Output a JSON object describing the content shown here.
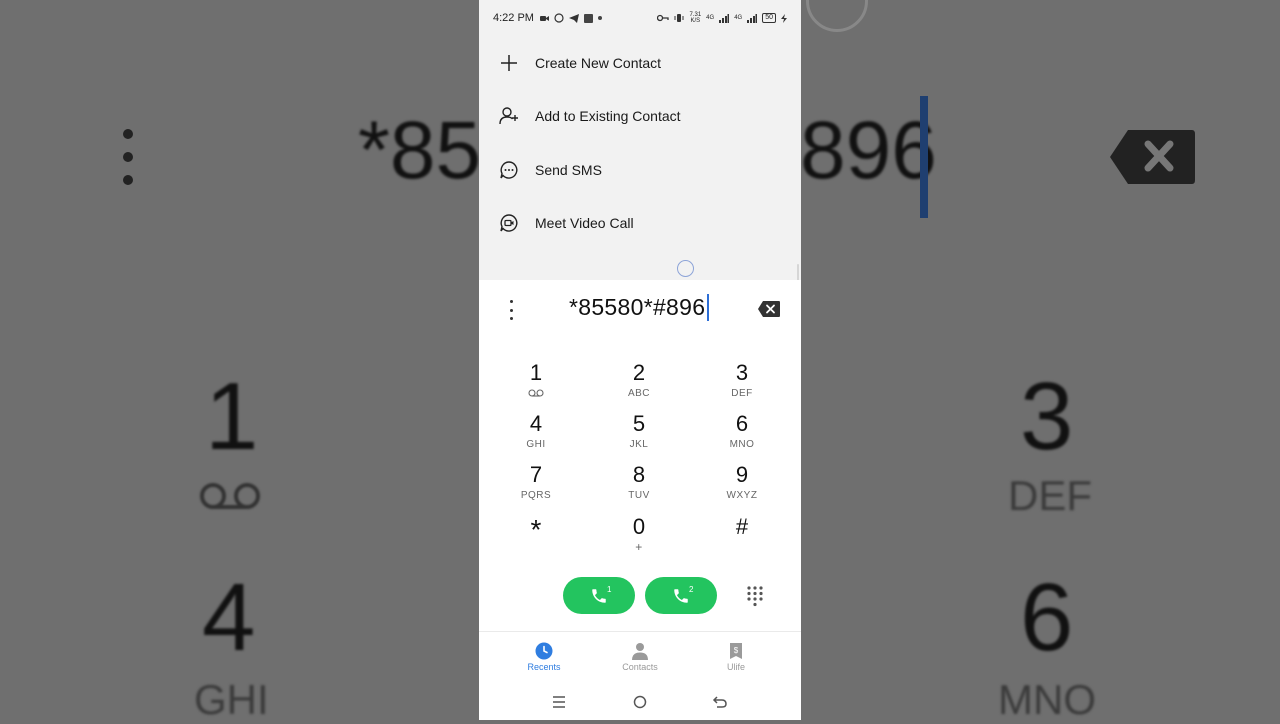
{
  "status_bar": {
    "time": "4:22 PM",
    "data_speed": "7.31",
    "data_unit": "K/S",
    "network_1": "4G",
    "network_2": "4G",
    "battery": "50"
  },
  "menu": {
    "items": [
      {
        "label": "Create New Contact",
        "icon": "plus-icon"
      },
      {
        "label": "Add to Existing Contact",
        "icon": "add-person-icon"
      },
      {
        "label": "Send SMS",
        "icon": "message-icon"
      },
      {
        "label": "Meet Video Call",
        "icon": "video-call-icon"
      }
    ]
  },
  "dialer": {
    "number": "*85580*#896",
    "keys": [
      {
        "digit": "1",
        "letters": ""
      },
      {
        "digit": "2",
        "letters": "ABC"
      },
      {
        "digit": "3",
        "letters": "DEF"
      },
      {
        "digit": "4",
        "letters": "GHI"
      },
      {
        "digit": "5",
        "letters": "JKL"
      },
      {
        "digit": "6",
        "letters": "MNO"
      },
      {
        "digit": "7",
        "letters": "PQRS"
      },
      {
        "digit": "8",
        "letters": "TUV"
      },
      {
        "digit": "9",
        "letters": "WXYZ"
      },
      {
        "digit": "*",
        "letters": ""
      },
      {
        "digit": "0",
        "letters": "+"
      },
      {
        "digit": "#",
        "letters": ""
      }
    ],
    "sim1_label": "1",
    "sim2_label": "2",
    "call_color": "#23c45f"
  },
  "bottom_nav": {
    "tabs": [
      {
        "label": "Recents",
        "active": true
      },
      {
        "label": "Contacts",
        "active": false
      },
      {
        "label": "Ulife",
        "active": false
      }
    ],
    "accent": "#2f7de0"
  },
  "background": {
    "number_fragment_left": "*85",
    "number_fragment_right": "896",
    "digits": [
      "1",
      "3",
      "4",
      "6"
    ],
    "letters": [
      "DEF",
      "GHI",
      "MNO"
    ]
  }
}
